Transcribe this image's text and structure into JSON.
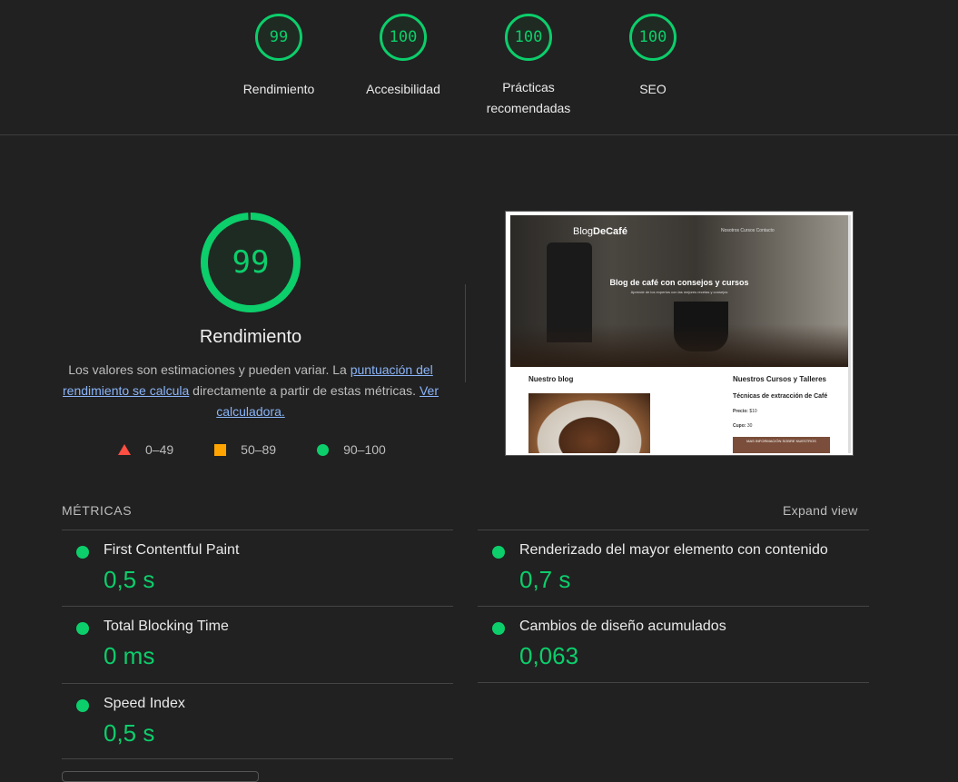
{
  "top_gauges": [
    {
      "score": "99",
      "label": "Rendimiento"
    },
    {
      "score": "100",
      "label": "Accesibilidad"
    },
    {
      "score": "100",
      "label": "Prácticas recomendadas"
    },
    {
      "score": "100",
      "label": "SEO"
    }
  ],
  "performance": {
    "score": "99",
    "score_fraction": 0.99,
    "title": "Rendimiento",
    "desc_before": "Los valores son estimaciones y pueden variar. La ",
    "desc_link1": "puntuación del rendimiento se calcula",
    "desc_middle": " directamente a partir de estas métricas. ",
    "desc_link2": "Ver calculadora.",
    "legend": [
      {
        "shape": "triangle",
        "range": "0–49",
        "color": "#ff4e42"
      },
      {
        "shape": "square",
        "range": "50–89",
        "color": "#ffa400"
      },
      {
        "shape": "circle",
        "range": "90–100",
        "color": "#0cce6b"
      }
    ]
  },
  "thumbnail": {
    "brand_plain": "Blog",
    "brand_bold": "DeCafé",
    "nav": "Nosotros   Cursos   Contacto",
    "hero_title": "Blog de café con consejos y cursos",
    "hero_subtitle": "Aprende de los expertos con las mejores recetas y consejos",
    "blog_heading": "Nuestro blog",
    "courses_heading": "Nuestros Cursos y Talleres",
    "course_title": "Técnicas de extracción de Café",
    "course_price_label": "Precio:",
    "course_price": "$10",
    "course_quota_label": "Cupo:",
    "course_quota": "30",
    "course_button": "MAS INFORMACIÓN SOBRE NUESTROS"
  },
  "metrics": {
    "title": "MÉTRICAS",
    "expand_label": "Expand view",
    "items": [
      {
        "name": "First Contentful Paint",
        "value": "0,5 s"
      },
      {
        "name": "Renderizado del mayor elemento con contenido",
        "value": "0,7 s"
      },
      {
        "name": "Total Blocking Time",
        "value": "0 ms"
      },
      {
        "name": "Cambios de diseño acumulados",
        "value": "0,063"
      },
      {
        "name": "Speed Index",
        "value": "0,5 s"
      }
    ]
  },
  "colors": {
    "pass": "#0cce6b",
    "average": "#ffa400",
    "fail": "#ff4e42",
    "background": "#212121"
  }
}
